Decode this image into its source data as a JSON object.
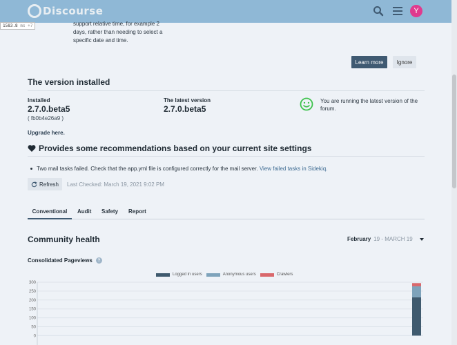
{
  "header": {
    "logo_text": "Discourse",
    "avatar_letter": "Y",
    "icons": [
      "search-icon",
      "hamburger-menu-icon"
    ]
  },
  "perf": {
    "value": "1583.8",
    "unit": "ms",
    "extra": "+7"
  },
  "tip": {
    "text": "support relative time, for example 2 days, rather than needing to select a specific date and time.",
    "learn_more": "Learn more",
    "ignore": "Ignore"
  },
  "version": {
    "heading": "The version installed",
    "installed_label": "Installed",
    "installed_value": "2.7.0.beta5",
    "installed_hash": "( fb0b4e26a9 )",
    "latest_label": "The latest version",
    "latest_value": "2.7.0.beta5",
    "status_message": "You are running the latest version of the forum.",
    "upgrade_link": "Upgrade here."
  },
  "recommendations": {
    "heading": "Provides some recommendations based on your current site settings",
    "item_text": "Two mail tasks failed. Check that the app.yml file is configured correctly for the mail server.",
    "item_link": "View failed tasks in Sidekiq.",
    "refresh_label": "Refresh",
    "last_checked": "Last Checked: March 19, 2021 9:02 PM"
  },
  "tabs": [
    {
      "label": "Conventional",
      "active": true
    },
    {
      "label": "Audit",
      "active": false
    },
    {
      "label": "Safety",
      "active": false
    },
    {
      "label": "Report",
      "active": false
    }
  ],
  "health": {
    "heading": "Community health",
    "period_month": "February",
    "period_range": "19 - MARCH 19"
  },
  "pageviews": {
    "heading": "Consolidated Pageviews"
  },
  "colors": {
    "accent": "#3f5a72",
    "header_bg": "#8fb8d6",
    "logged_in": "#3f5a6e",
    "anonymous": "#7ea3bb",
    "crawlers": "#d9686c"
  },
  "chart_data": {
    "type": "bar",
    "stacked": true,
    "title": "Consolidated Pageviews",
    "y_ticks": [
      "0",
      "50",
      "100",
      "150",
      "200",
      "250",
      "300"
    ],
    "ylim": [
      0,
      300
    ],
    "grid": true,
    "legend_position": "top",
    "series": [
      {
        "name": "Logged in users",
        "color": "#3f5a6e",
        "values": [
          215
        ]
      },
      {
        "name": "Anonymous users",
        "color": "#7ea3bb",
        "values": [
          62
        ]
      },
      {
        "name": "Crawlers",
        "color": "#d9686c",
        "values": [
          18
        ]
      }
    ]
  }
}
